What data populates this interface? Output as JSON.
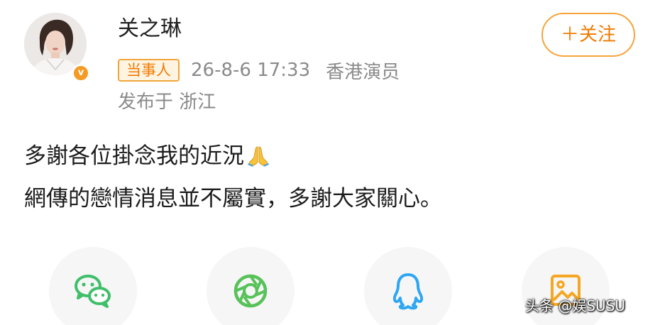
{
  "user": {
    "name": "关之琳",
    "verified_mark": "v",
    "badge_label": "当事人",
    "timestamp": "26-8-6 17:33",
    "source": "香港演员",
    "location": "发布于 浙江"
  },
  "follow_button": {
    "label": "＋关注"
  },
  "post": {
    "line1": "多謝各位掛念我的近況",
    "line1_emoji": "folded-hands-icon",
    "line2": "網傳的戀情消息並不屬實，多謝大家關心。"
  },
  "share_targets": [
    {
      "icon": "wechat-icon",
      "color": "#3fbf6a"
    },
    {
      "icon": "moments-icon",
      "color": "#58c25a"
    },
    {
      "icon": "qq-icon",
      "color": "#2ea6f2"
    },
    {
      "icon": "gallery-icon",
      "color": "#f5a623"
    }
  ],
  "watermark": "头条 @娱SUSU",
  "colors": {
    "accent": "#f07a00",
    "badge_border": "#f2a43a",
    "badge_bg": "#fff4e2",
    "meta_text": "#8a8a8a",
    "body_text": "#1c1c1c"
  }
}
